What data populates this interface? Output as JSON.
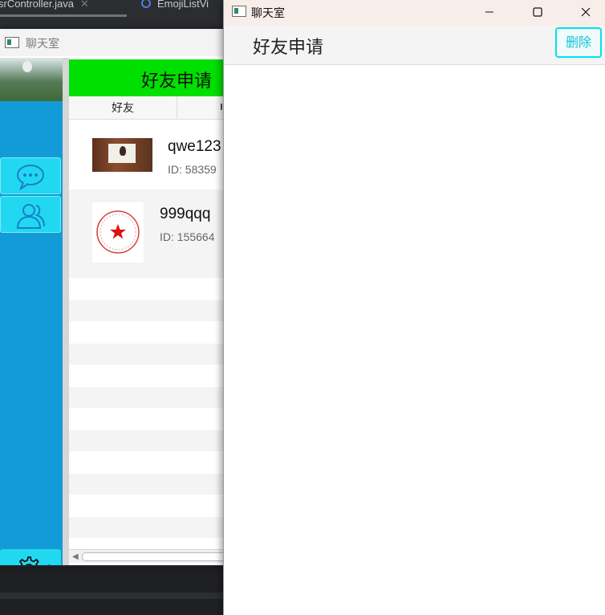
{
  "ide": {
    "tabs": [
      {
        "label": "srController.java"
      },
      {
        "label": "EmojiListVi"
      }
    ]
  },
  "back_window": {
    "title": "聊天室",
    "panel_title": "好友申请",
    "tabs": [
      {
        "label": "好友"
      },
      {
        "label": ""
      }
    ],
    "friends": [
      {
        "name": "qwe123",
        "id": "ID: 58359"
      },
      {
        "name": "999qqq",
        "id": "ID: 155664"
      }
    ]
  },
  "front_window": {
    "title": "聊天室",
    "header_title": "好友申请",
    "delete_label": "删除"
  }
}
